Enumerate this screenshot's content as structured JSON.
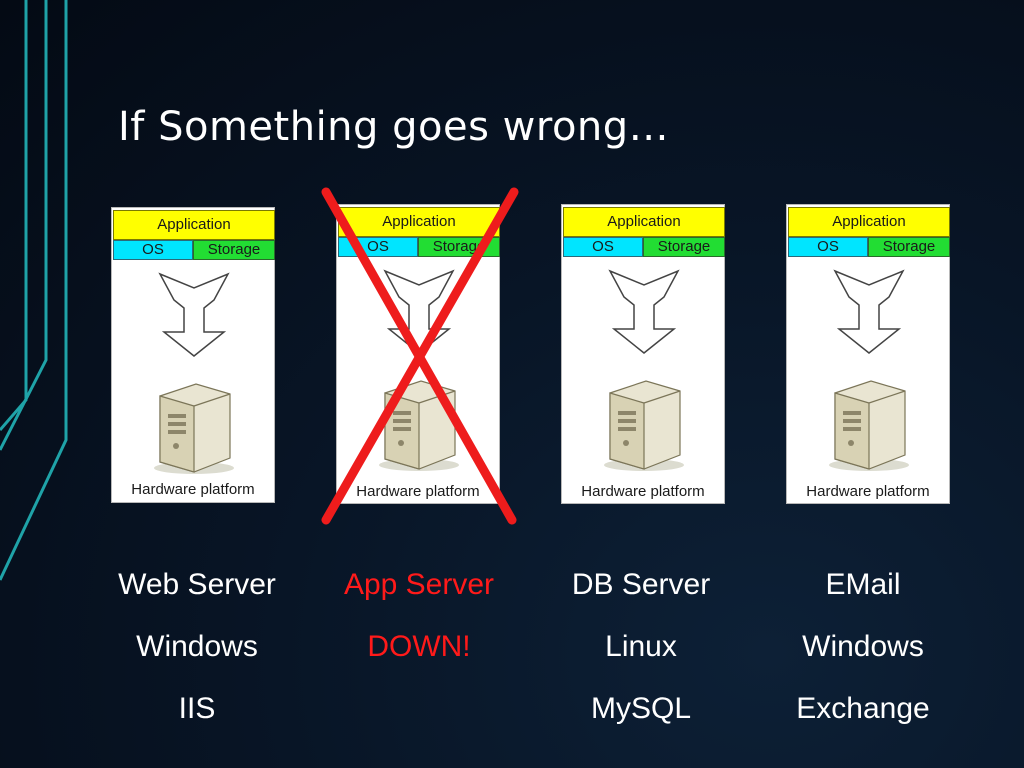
{
  "title": "If Something goes wrong…",
  "colors": {
    "background": "#081526",
    "accent_line": "#1fa3a8",
    "application": "#ffff00",
    "os": "#00e5ff",
    "storage": "#22dd33",
    "failure": "#ff1a1a"
  },
  "stacks": [
    {
      "application": "Application",
      "os": "OS",
      "storage": "Storage",
      "hardware": "Hardware platform",
      "labels": [
        "Web Server",
        "Windows",
        "IIS"
      ],
      "status": "up"
    },
    {
      "application": "Application",
      "os": "OS",
      "storage": "Storage",
      "hardware": "Hardware platform",
      "labels": [
        "App Server",
        "DOWN!",
        ""
      ],
      "status": "down"
    },
    {
      "application": "Application",
      "os": "OS",
      "storage": "Storage",
      "hardware": "Hardware platform",
      "labels": [
        "DB Server",
        "Linux",
        "MySQL"
      ],
      "status": "up"
    },
    {
      "application": "Application",
      "os": "OS",
      "storage": "Storage",
      "hardware": "Hardware platform",
      "labels": [
        "EMail",
        "Windows",
        "Exchange"
      ],
      "status": "up"
    }
  ],
  "icons": [
    "down-arrow-icon",
    "server-tower-icon",
    "red-x-icon"
  ]
}
